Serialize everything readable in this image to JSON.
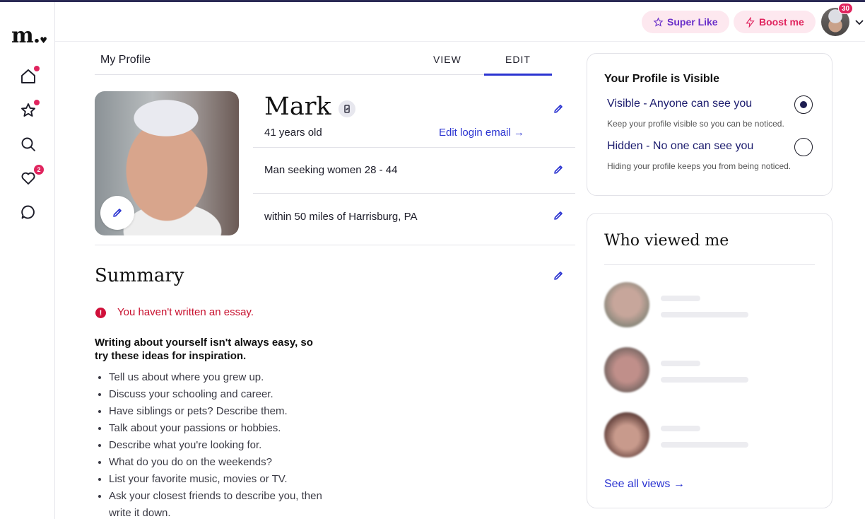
{
  "brand": {
    "logo": "m.",
    "logo_heart": "♥"
  },
  "nav": {
    "likes_count": "2"
  },
  "topbar": {
    "super_like": "Super Like",
    "boost": "Boost me",
    "notification_count": "30"
  },
  "profile": {
    "page_title": "My Profile",
    "tabs": [
      {
        "label": "VIEW",
        "active": false
      },
      {
        "label": "EDIT",
        "active": true
      }
    ],
    "name": "Mark",
    "age": "41 years old",
    "edit_login_email": "Edit login email →",
    "seeking": "Man seeking women 28 - 44",
    "location": "within 50 miles of Harrisburg, PA"
  },
  "summary": {
    "title": "Summary",
    "warning_icon": "!",
    "warning": "You haven't written an essay.",
    "tips_heading": "Writing about yourself isn't always easy, so try these ideas for inspiration.",
    "tips": [
      "Tell us about where you grew up.",
      "Discuss your schooling and career.",
      "Have siblings or pets? Describe them.",
      "Talk about your passions or hobbies.",
      "Describe what you're looking for.",
      "What do you do on the weekends?",
      "List your favorite music, movies or TV.",
      "Ask your closest friends to describe you, then write it down."
    ]
  },
  "visibility": {
    "title": "Your Profile is Visible",
    "options": [
      {
        "label": "Visible - Anyone can see you",
        "description": "Keep your profile visible so you can be noticed.",
        "selected": true
      },
      {
        "label": "Hidden - No one can see you",
        "description": "Hiding your profile keeps you from being noticed.",
        "selected": false
      }
    ]
  },
  "viewers": {
    "title": "Who viewed me",
    "see_all": "See all views →"
  },
  "colors": {
    "accent": "#2b34d1",
    "alert": "#e0245e",
    "error": "#c8102e",
    "pill_bg": "#fde8ef"
  }
}
